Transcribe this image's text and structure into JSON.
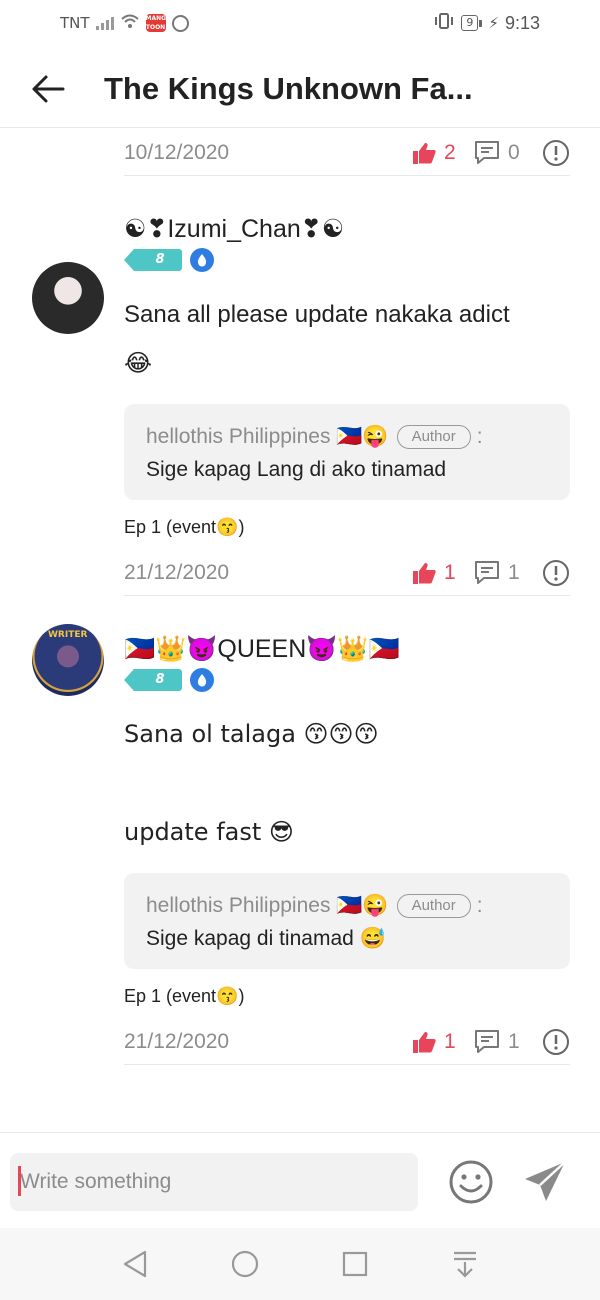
{
  "status": {
    "carrier": "TNT",
    "battery": "9",
    "time": "9:13",
    "app_badge": "MANGA TOON"
  },
  "header": {
    "title": "The Kings Unknown Fa..."
  },
  "previous": {
    "date": "10/12/2020",
    "likes": "2",
    "replies": "0"
  },
  "comments": [
    {
      "username": "☯❣Izumi_Chan❣☯",
      "level": "8",
      "text_lines": [
        "Sana all please update nakaka adict",
        "😂"
      ],
      "reply": {
        "author": "hellothis Philippines 🇵🇭😜",
        "tag": "Author",
        "text": "Sige kapag Lang di ako tinamad"
      },
      "episode": "Ep 1 (event😙)",
      "date": "21/12/2020",
      "likes": "1",
      "replies": "1"
    },
    {
      "username": "🇵🇭👑😈QUEEN😈👑🇵🇭",
      "avatar_text": "WRITER",
      "level": "8",
      "text_lines": [
        "Sana ol talaga 😙😙😙",
        "",
        "update fast 😎"
      ],
      "reply": {
        "author": "hellothis Philippines 🇵🇭😜",
        "tag": "Author",
        "text": "Sige kapag di tinamad 😅"
      },
      "episode": "Ep 1 (event😙)",
      "date": "21/12/2020",
      "likes": "1",
      "replies": "1"
    }
  ],
  "composer": {
    "placeholder": "Write something"
  },
  "colors": {
    "accent": "#e8455a",
    "muted": "#8c8c8c",
    "level_badge": "#4fc6c6"
  }
}
